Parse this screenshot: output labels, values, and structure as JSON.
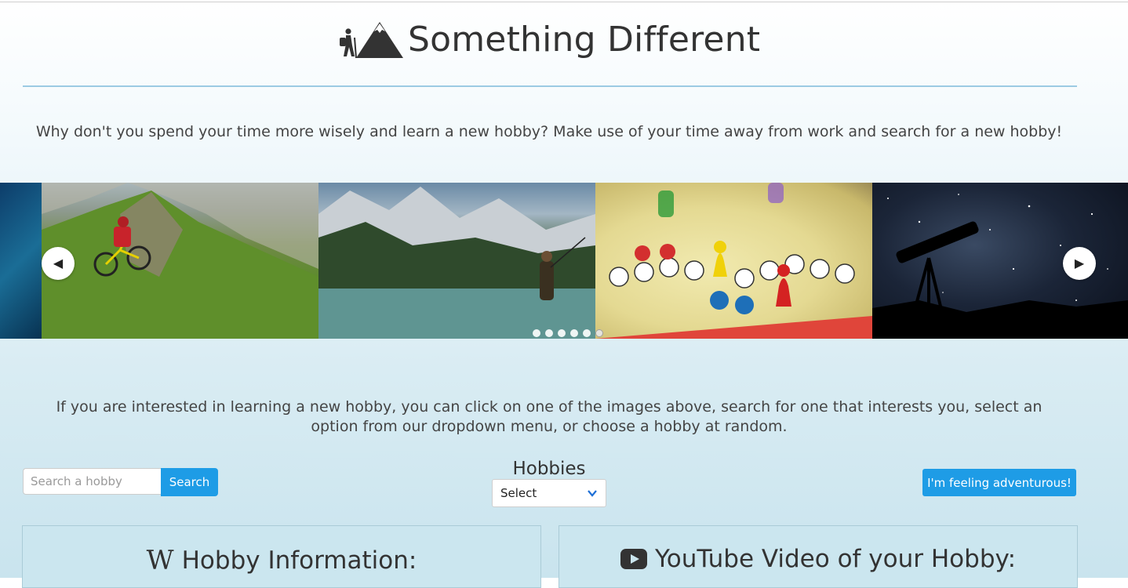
{
  "header": {
    "title": "Something Different",
    "logo_icon": "hiker-mountain-icon"
  },
  "intro": {
    "text": "Why don't you spend your time more wisely and learn a new hobby? Make use of your time away from work and search for a new hobby!"
  },
  "carousel": {
    "slides": [
      {
        "icon": "ocean-image"
      },
      {
        "icon": "mountain-biking-image"
      },
      {
        "icon": "fishing-lake-image"
      },
      {
        "icon": "board-game-image"
      },
      {
        "icon": "stargazing-telescope-image"
      }
    ],
    "indicator_count": 6,
    "active_index": 5,
    "prev_icon": "chevron-left-icon",
    "next_icon": "chevron-right-icon"
  },
  "explain": {
    "text": "If you are interested in learning a new hobby, you can click on one of the images above, search for one that interests you, select an option from our dropdown menu, or choose a hobby at random."
  },
  "search": {
    "placeholder": "Search a hobby",
    "button_label": "Search"
  },
  "dropdown": {
    "label": "Hobbies",
    "selected": "Select"
  },
  "random": {
    "button_label": "I'm feeling adventurous!"
  },
  "panels": {
    "wiki": {
      "icon": "wikipedia-icon",
      "glyph": "W",
      "title": "Hobby Information:"
    },
    "youtube": {
      "icon": "youtube-icon",
      "title": "YouTube Video of your Hobby:"
    }
  },
  "colors": {
    "accent": "#1e9ce6",
    "divider": "#9ccbe3",
    "background_bottom": "#c9e4ee",
    "text": "#333333"
  }
}
